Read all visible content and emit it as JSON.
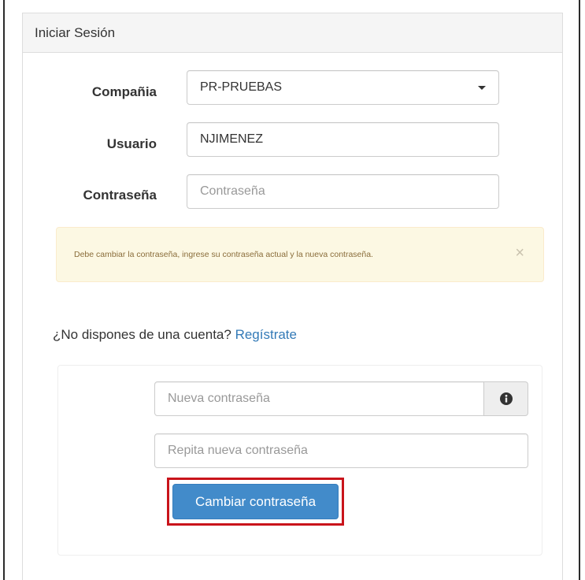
{
  "panel": {
    "title": "Iniciar Sesión"
  },
  "form": {
    "company": {
      "label": "Compañia",
      "value": "PR-PRUEBAS"
    },
    "user": {
      "label": "Usuario",
      "value": "NJIMENEZ"
    },
    "password": {
      "label": "Contraseña",
      "placeholder": "Contraseña"
    }
  },
  "alert": {
    "message": "Debe cambiar la contraseña, ingrese su contraseña actual y la nueva contraseña.",
    "close_symbol": "×"
  },
  "signup": {
    "question": "¿No dispones de una cuenta?",
    "link_label": "Regístrate"
  },
  "change_password": {
    "new_placeholder": "Nueva contraseña",
    "repeat_placeholder": "Repita nueva contraseña",
    "submit_label": "Cambiar contraseña",
    "info_icon": "info-circle-icon"
  },
  "colors": {
    "primary": "#428bca",
    "highlight": "#c9141b",
    "alert_bg": "#fcf8e3",
    "link": "#337ab7"
  }
}
